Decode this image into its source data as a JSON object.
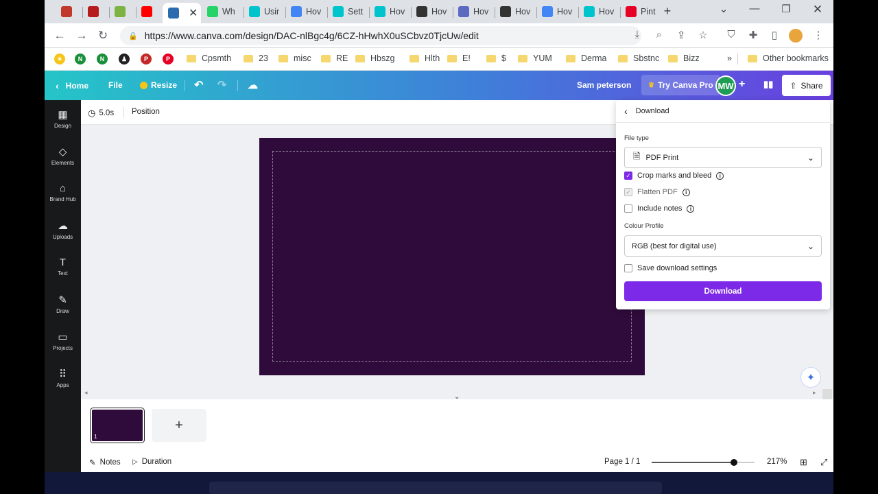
{
  "tabs": [
    {
      "label": "",
      "color": "#c0392b"
    },
    {
      "label": "",
      "color": "#b71c1c"
    },
    {
      "label": "",
      "color": "#7cb342"
    },
    {
      "label": "",
      "color": "#ff0000"
    },
    {
      "label": "",
      "color": "#2b6cb0",
      "active": true
    },
    {
      "label": "Wh",
      "color": "#25d366"
    },
    {
      "label": "Usir",
      "color": "#00c4cc"
    },
    {
      "label": "Hov",
      "color": "#4285f4"
    },
    {
      "label": "Sett",
      "color": "#00c4cc"
    },
    {
      "label": "Hov",
      "color": "#00c4cc"
    },
    {
      "label": "Hov",
      "color": "#333333"
    },
    {
      "label": "Hov",
      "color": "#5c6bc0"
    },
    {
      "label": "Hov",
      "color": "#333333"
    },
    {
      "label": "Hov",
      "color": "#4285f4"
    },
    {
      "label": "Hov",
      "color": "#00c4cc"
    },
    {
      "label": "Pint",
      "color": "#e60023"
    }
  ],
  "address": {
    "url": "https://www.canva.com/design/DAC-nlBgc4g/6CZ-hHwhX0uSCbvz0TjcUw/edit"
  },
  "bookmarks": {
    "icons": [
      {
        "glyph": "✶",
        "color": "#f5c518"
      },
      {
        "glyph": "N",
        "color": "#1a8f3a"
      },
      {
        "glyph": "N",
        "color": "#1a8f3a"
      },
      {
        "glyph": "♟",
        "color": "#222222"
      },
      {
        "glyph": "P",
        "color": "#c62828"
      },
      {
        "glyph": "P",
        "color": "#e60023"
      }
    ],
    "folders": [
      "Cpsmth",
      "23",
      "misc",
      "RE",
      "Hbszg",
      "Hlth",
      "E!",
      "$",
      "YUM",
      "Derma",
      "Sbstnc",
      "Bizz"
    ],
    "more": "»",
    "other": "Other bookmarks"
  },
  "header": {
    "home": "Home",
    "file": "File",
    "resize": "Resize",
    "user": "Sam peterson",
    "try_pro": "Try Canva Pro",
    "avatar": "MW",
    "share": "Share"
  },
  "sidebar": [
    {
      "label": "Design",
      "icon": "▦"
    },
    {
      "label": "Elements",
      "icon": "◇"
    },
    {
      "label": "Brand Hub",
      "icon": "⌂"
    },
    {
      "label": "Uploads",
      "icon": "☁"
    },
    {
      "label": "Text",
      "icon": "T"
    },
    {
      "label": "Draw",
      "icon": "✎"
    },
    {
      "label": "Projects",
      "icon": "▭"
    },
    {
      "label": "Apps",
      "icon": "⠿"
    }
  ],
  "toolbar": {
    "duration": "5.0s",
    "position": "Position"
  },
  "download": {
    "title": "Download",
    "file_type_label": "File type",
    "file_type": "PDF Print",
    "options": [
      {
        "label": "Crop marks and bleed",
        "state": "checked"
      },
      {
        "label": "Flatten PDF",
        "state": "disabled"
      },
      {
        "label": "Include notes",
        "state": "unchecked"
      }
    ],
    "colour_profile_label": "Colour Profile",
    "colour_profile": "RGB (best for digital use)",
    "save_settings": "Save download settings",
    "button": "Download"
  },
  "pages": {
    "thumb_number": "1",
    "add": "+"
  },
  "footer": {
    "notes": "Notes",
    "duration": "Duration",
    "page": "Page 1 / 1",
    "zoom": "217%",
    "zoom_level": 0.8
  },
  "colors": {
    "accent": "#7d2ae8",
    "design_bg": "#2e0b3a"
  }
}
